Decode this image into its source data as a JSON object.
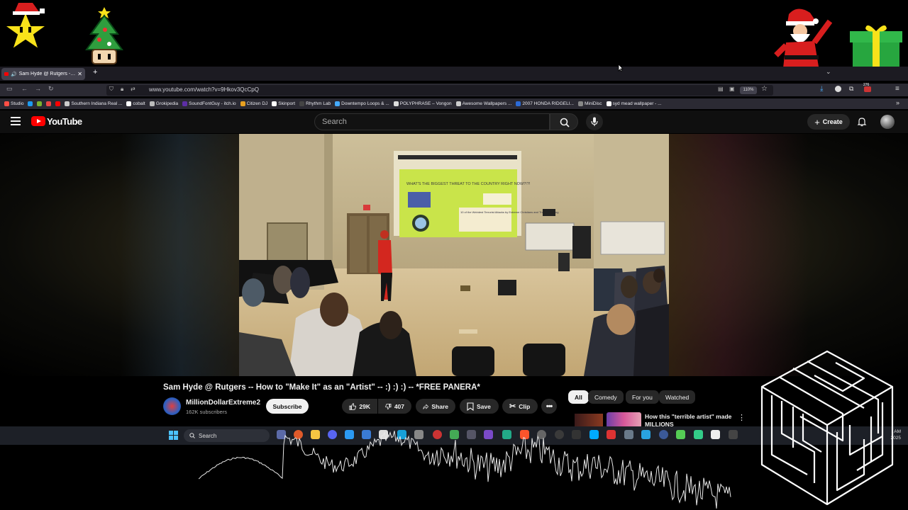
{
  "browser": {
    "tab_title": "Sam Hyde @ Rutgers -- Ho",
    "new_tab_icon": "plus-icon",
    "url": "www.youtube.com/watch?v=9Hkov3QcCpQ",
    "zoom": "110%",
    "badge_count": "276"
  },
  "bookmarks": [
    {
      "label": "Studio",
      "color": "#ff4e45"
    },
    {
      "label": "",
      "color": "#1d9bf0"
    },
    {
      "label": "",
      "color": "#7bb32e"
    },
    {
      "label": "",
      "color": "#e44"
    },
    {
      "label": "",
      "color": "#ff0000"
    },
    {
      "label": "Southern Indiana Real ...",
      "color": "#ccc"
    },
    {
      "label": "cobalt",
      "color": "#fff"
    },
    {
      "label": "Grokipedia",
      "color": "#bbb"
    },
    {
      "label": "SoundFontGuy - itch.io",
      "color": "#5d2ea6"
    },
    {
      "label": "Citizen DJ",
      "color": "#e8a020"
    },
    {
      "label": "Skinport",
      "color": "#fff"
    },
    {
      "label": "Rhythm Lab",
      "color": "#444"
    },
    {
      "label": "Downtempo Loops & ...",
      "color": "#4af"
    },
    {
      "label": "POLYPHRASE – Vongon",
      "color": "#ddd"
    },
    {
      "label": "Awesome Wallpapers ...",
      "color": "#ccc"
    },
    {
      "label": "2007 HONDA RIDGELI...",
      "color": "#2b6ad6"
    },
    {
      "label": "MiniDisc",
      "color": "#888"
    },
    {
      "label": "syd mead wallpaper - ...",
      "color": "#fff"
    }
  ],
  "youtube": {
    "logo_text": "YouTube",
    "search_placeholder": "Search",
    "create_label": "Create",
    "video_title": "Sam Hyde @ Rutgers -- How to \"Make It\" as an \"Artist\" -- :) :) :) -- *FREE PANERA*",
    "channel_name": "MillionDollarExtreme2",
    "subscribers": "162K subscribers",
    "subscribe_label": "Subscribe",
    "likes": "29K",
    "dislikes": "407",
    "share_label": "Share",
    "save_label": "Save",
    "clip_label": "Clip",
    "filter_chips": [
      "All",
      "Comedy",
      "For you",
      "Watched"
    ],
    "recommended_title": "How this \"terrible artist\" made MILLIONS",
    "slide_heading": "WHAT'S THE BIGGEST THREAT TO THE COUNTRY RIGHT NOW?!?!",
    "slide_text": "10 of the Weirdest Terrorist Attacks by Extreme Christians and The Right Wing"
  },
  "taskbar": {
    "search_label": "Search",
    "time": "AM",
    "date": "2025"
  },
  "colors": {
    "youtube_red": "#ff0000",
    "bg": "#0f0f0f",
    "chip_bg": "#272727"
  }
}
